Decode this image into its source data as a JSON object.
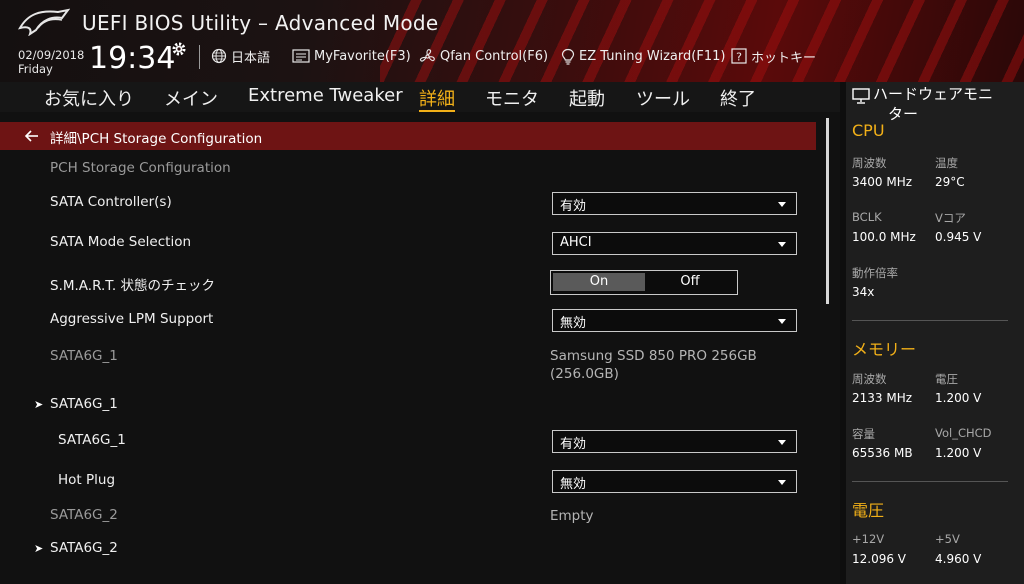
{
  "app": {
    "title": "UEFI BIOS Utility – Advanced Mode"
  },
  "header": {
    "date": "02/09/2018",
    "day": "Friday",
    "time": "19:34",
    "tools": [
      {
        "label": "日本語",
        "icon": "globe-icon"
      },
      {
        "label": "MyFavorite(F3)",
        "icon": "favorite-list-icon"
      },
      {
        "label": "Qfan Control(F6)",
        "icon": "fan-icon"
      },
      {
        "label": "EZ Tuning Wizard(F11)",
        "icon": "lightbulb-icon"
      },
      {
        "label": "ホットキー",
        "icon": "help-key-icon"
      }
    ]
  },
  "menu": {
    "items": [
      "お気に入り",
      "メイン",
      "Extreme Tweaker",
      "詳細",
      "モニタ",
      "起動",
      "ツール",
      "終了"
    ],
    "active": "詳細"
  },
  "breadcrumb": {
    "text": "詳細\\PCH Storage Configuration"
  },
  "settings": {
    "section_title": "PCH Storage Configuration",
    "sata_controller": {
      "label": "SATA Controller(s)",
      "value": "有効"
    },
    "sata_mode": {
      "label": "SATA Mode Selection",
      "value": "AHCI"
    },
    "smart": {
      "label": "S.M.A.R.T. 状態のチェック",
      "on": "On",
      "off": "Off",
      "selected": "On"
    },
    "lpm": {
      "label": "Aggressive LPM Support",
      "value": "無効"
    },
    "sata6g_1_info": {
      "label": "SATA6G_1",
      "value_line1": "Samsung SSD 850 PRO 256GB",
      "value_line2": "(256.0GB)"
    },
    "sata6g_1_sub": {
      "label": "SATA6G_1"
    },
    "sata6g_1_port": {
      "label": "SATA6G_1",
      "value": "有効"
    },
    "hot_plug": {
      "label": "Hot Plug",
      "value": "無効"
    },
    "sata6g_2_info": {
      "label": "SATA6G_2",
      "value": "Empty"
    },
    "sata6g_2_sub": {
      "label": "SATA6G_2"
    }
  },
  "hw_monitor": {
    "title_line1": "ハードウェアモニ",
    "title_line2": "ター",
    "cpu": {
      "title": "CPU",
      "freq_label": "周波数",
      "freq": "3400 MHz",
      "temp_label": "温度",
      "temp": "29°C",
      "bclk_label": "BCLK",
      "bclk": "100.0 MHz",
      "vcore_label": "Vコア",
      "vcore": "0.945 V",
      "ratio_label": "動作倍率",
      "ratio": "34x"
    },
    "memory": {
      "title": "メモリー",
      "freq_label": "周波数",
      "freq": "2133 MHz",
      "volt_label": "電圧",
      "volt": "1.200 V",
      "cap_label": "容量",
      "cap": "65536 MB",
      "vol_chcd_label": "Vol_CHCD",
      "vol_chcd": "1.200 V"
    },
    "voltage": {
      "title": "電圧",
      "v12_label": "+12V",
      "v12": "12.096 V",
      "v5_label": "+5V",
      "v5": "4.960 V"
    }
  },
  "colors": {
    "accent": "#f2b018",
    "breadcrumb_bg": "#6e1414",
    "panel_bg": "#1e1e1e"
  }
}
